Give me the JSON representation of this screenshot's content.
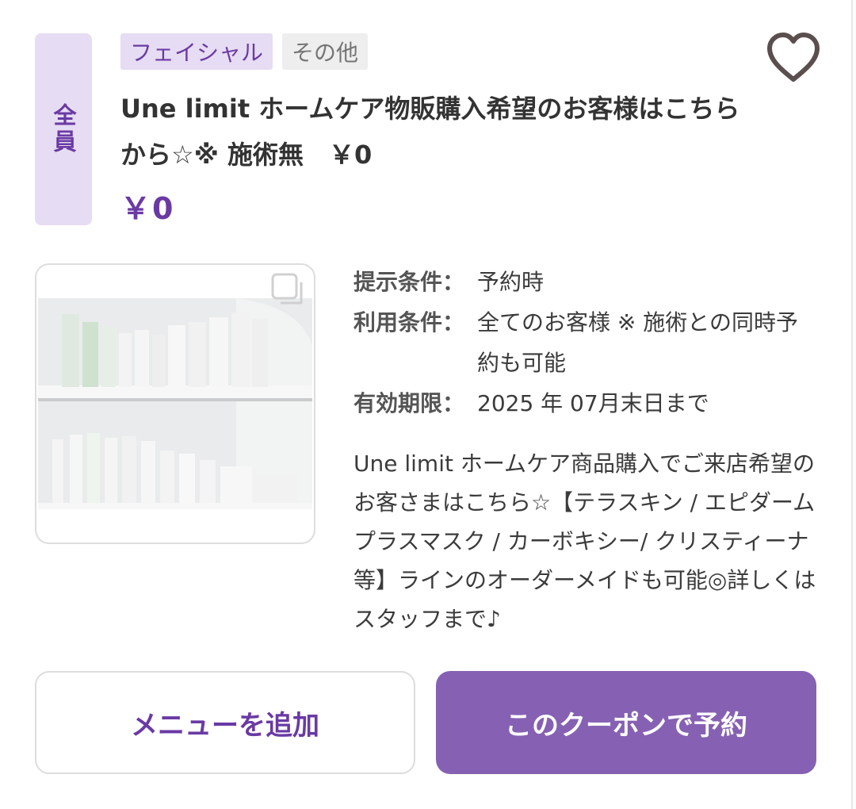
{
  "coupon": {
    "target_label": "全員",
    "tags": [
      "フェイシャル",
      "その他"
    ],
    "title": "Une limit ホームケア物販購入希望のお客様はこちらから☆※ 施術無　￥0",
    "price": "￥0",
    "conditions": [
      {
        "label": "提示条件：",
        "value": "予約時"
      },
      {
        "label": "利用条件：",
        "value": "全てのお客様 ※ 施術との同時予約も可能"
      },
      {
        "label": "有効期限：",
        "value": "2025 年 07月末日まで"
      }
    ],
    "description": "Une limit ホームケア商品購入でご来店希望のお客さまはこちら☆【テラスキン / エピダームプラスマスク / カーボキシー/ クリスティーナ等】ラインのオーダーメイドも可能◎詳しくはスタッフまで♪",
    "image": {
      "type": "photo",
      "subject": "shelf-with-skincare-products"
    },
    "favorite_icon": "heart-outline-icon",
    "multi_image_icon": "stacked-images-icon"
  },
  "buttons": {
    "add_menu": "メニューを追加",
    "reserve": "このクーポンで予約"
  },
  "colors": {
    "accent": "#6a3aa4",
    "accent_light": "#e6dcf3",
    "button_primary": "#8661b3"
  }
}
